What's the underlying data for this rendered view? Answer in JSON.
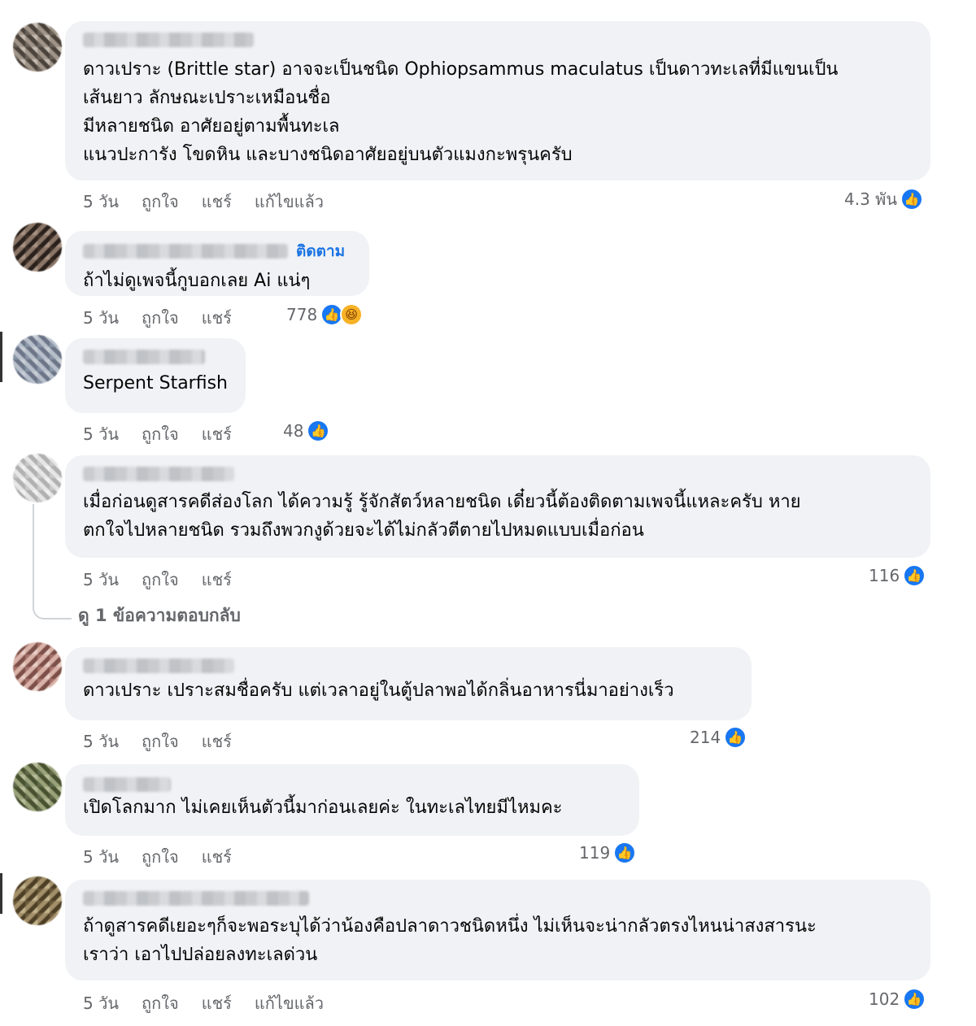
{
  "actions": {
    "like": "ถูกใจ",
    "share": "แชร์",
    "edited": "แก้ไขแล้ว"
  },
  "replies_link": "ดู 1 ข้อความตอบกลับ",
  "follow_label": "ติดตาม",
  "comments": [
    {
      "text": "ดาวเปราะ (Brittle star) อาจจะเป็นชนิด Ophiopsammus maculatus เป็นดาวทะเลที่มีแขนเป็น\nเส้นยาว ลักษณะเปราะเหมือนชื่อ\nมีหลายชนิด อาศัยอยู่ตามพื้นทะเล\nแนวปะการัง โขดหิน และบางชนิดอาศัยอยู่บนตัวแมงกะพรุนครับ",
      "time": "5 วัน",
      "reactions": "4.3 พัน"
    },
    {
      "text": "ถ้าไม่ดูเพจนี้กูบอกเลย Ai แน่ๆ",
      "time": "5 วัน",
      "reactions": "778"
    },
    {
      "text": "Serpent Starfish",
      "time": "5 วัน",
      "reactions": "48"
    },
    {
      "text": "เมื่อก่อนดูสารคดีส่องโลก ได้ความรู้ รู้จักสัตว์หลายชนิด เดี๋ยวนี้ต้องติดตามเพจนี้แหละครับ หาย\nตกใจไปหลายชนิด รวมถึงพวกงูด้วยจะได้ไม่กลัวตีตายไปหมดแบบเมื่อก่อน",
      "time": "5 วัน",
      "reactions": "116"
    },
    {
      "text": "ดาวเปราะ เปราะสมชื่อครับ แต่เวลาอยู่ในตู้ปลาพอได้กลิ่นอาหารนี่มาอย่างเร็ว",
      "time": "5 วัน",
      "reactions": "214"
    },
    {
      "text": "เปิดโลกมาก ไม่เคยเห็นตัวนี้มาก่อนเลยค่ะ ในทะเลไทยมีไหมคะ",
      "time": "5 วัน",
      "reactions": "119"
    },
    {
      "text": "ถ้าดูสารคดีเยอะๆก็จะพอระบุได้ว่าน้องคือปลาดาวชนิดหนึ่ง ไม่เห็นจะน่ากลัวตรงไหนน่าสงสารนะ\nเราว่า เอาไปปล่อยลงทะเลด่วน",
      "time": "5 วัน",
      "reactions": "102"
    }
  ]
}
